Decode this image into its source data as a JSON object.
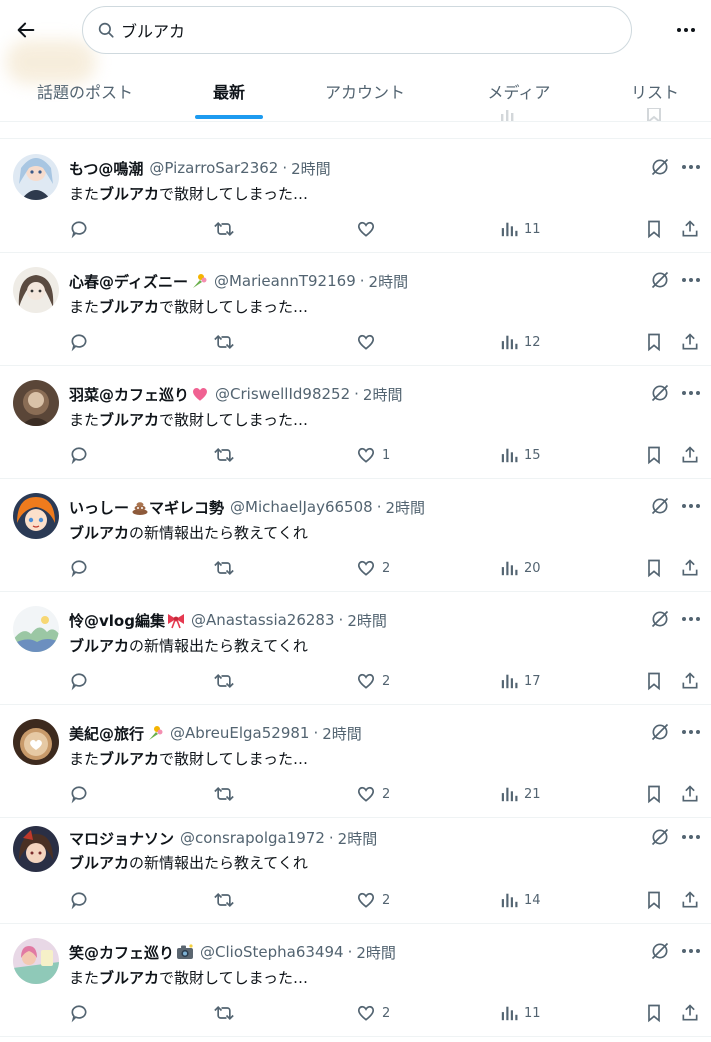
{
  "search": {
    "query": "ブルアカ"
  },
  "tabs": [
    {
      "label": "話題のポスト",
      "active": false
    },
    {
      "label": "最新",
      "active": true
    },
    {
      "label": "アカウント",
      "active": false
    },
    {
      "label": "メディア",
      "active": false
    },
    {
      "label": "リスト",
      "active": false
    }
  ],
  "colors": {
    "accent": "#1d9bf0",
    "text": "#0f1419",
    "muted": "#536471",
    "divider": "#eff3f4"
  },
  "posts": [
    {
      "name": "もつ@鳴潮",
      "emoji": "",
      "handle": "@PizarroSar2362",
      "dot": "·",
      "time": "2時間",
      "text_pre": "また",
      "text_bold": "ブルアカ",
      "text_post": "で散財してしまった…",
      "likes": "",
      "views": "11"
    },
    {
      "name": "心春@ディズニー",
      "emoji": "bouquet-emoji",
      "handle": "@MarieannT92169",
      "dot": "·",
      "time": "2時間",
      "text_pre": "また",
      "text_bold": "ブルアカ",
      "text_post": "で散財してしまった…",
      "likes": "",
      "views": "12"
    },
    {
      "name": "羽菜@カフェ巡り",
      "emoji": "heart-emoji",
      "handle": "@CriswellId98252",
      "dot": "·",
      "time": "2時間",
      "text_pre": "また",
      "text_bold": "ブルアカ",
      "text_post": "で散財してしまった…",
      "likes": "1",
      "views": "15"
    },
    {
      "name": "いっしー",
      "name_b": "マギレコ勢",
      "emoji": "poop-emoji",
      "handle": "@MichaelJay66508",
      "dot": "·",
      "time": "2時間",
      "text_pre": "",
      "text_bold": "ブルアカ",
      "text_post": "の新情報出たら教えてくれ",
      "likes": "2",
      "views": "20"
    },
    {
      "name": "怜@vlog編集",
      "emoji": "ribbon-emoji",
      "handle": "@Anastassia26283",
      "dot": "·",
      "time": "2時間",
      "text_pre": "",
      "text_bold": "ブルアカ",
      "text_post": "の新情報出たら教えてくれ",
      "likes": "2",
      "views": "17"
    },
    {
      "name": "美紀@旅行",
      "emoji": "bouquet-emoji",
      "handle": "@AbreuElga52981",
      "dot": "·",
      "time": "2時間",
      "text_pre": "また",
      "text_bold": "ブルアカ",
      "text_post": "で散財してしまった…",
      "likes": "2",
      "views": "21"
    },
    {
      "name": "マロジョナソン",
      "emoji": "",
      "handle": "@consrapolga1972",
      "dot": "·",
      "time": "2時間",
      "text_pre": "",
      "text_bold": "ブルアカ",
      "text_post": "の新情報出たら教えてくれ",
      "likes": "2",
      "views": "14"
    },
    {
      "name": "笑@カフェ巡り",
      "emoji": "camera-emoji",
      "handle": "@ClioStepha63494",
      "dot": "·",
      "time": "2時間",
      "text_pre": "また",
      "text_bold": "ブルアカ",
      "text_post": "で散財してしまった…",
      "likes": "2",
      "views": "11"
    }
  ]
}
